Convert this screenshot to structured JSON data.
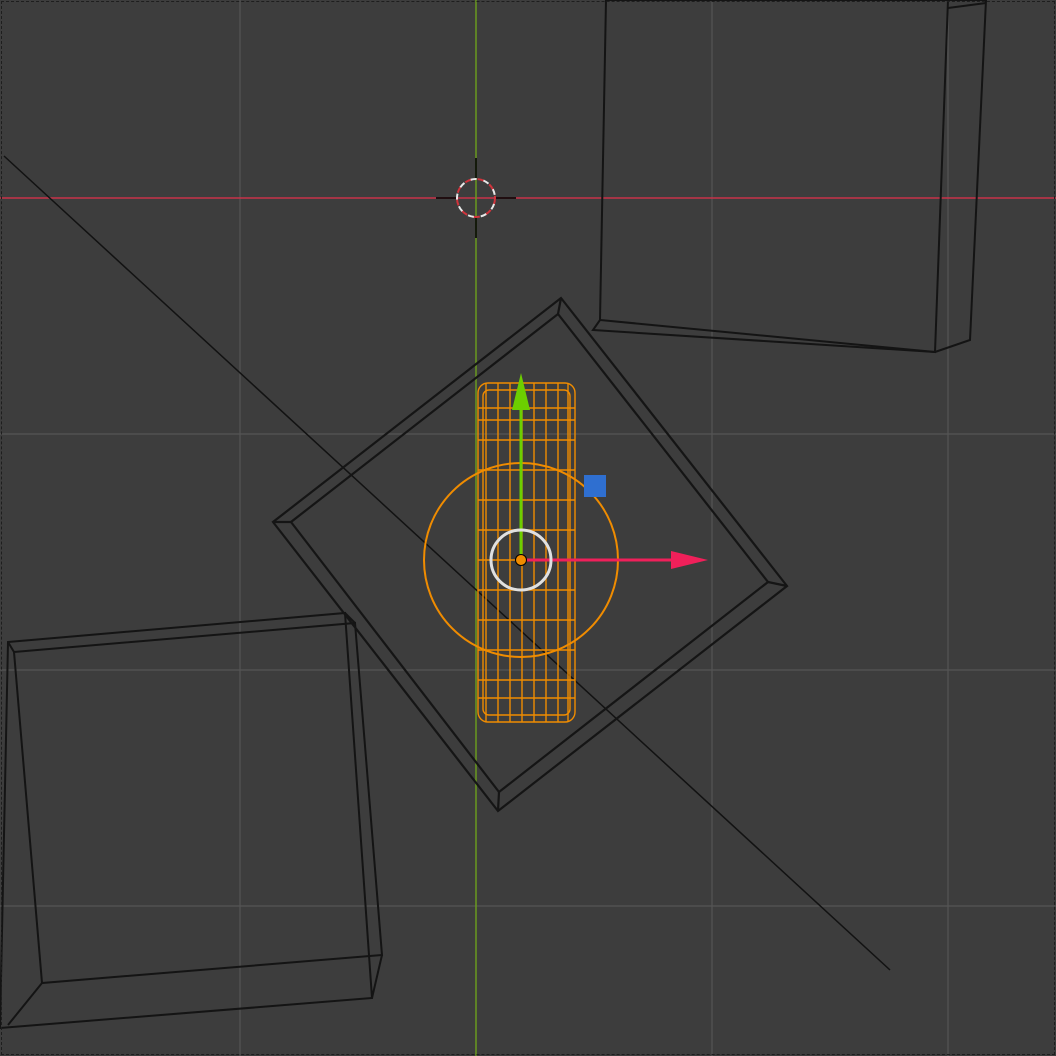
{
  "viewport": {
    "view": "top-orthographic",
    "shading": "wireframe"
  },
  "colors": {
    "background": "#3d3d3d",
    "grid": "#555555",
    "x_axis": "#c8334a",
    "y_axis": "#6a9a1e",
    "selection": "#f08c00",
    "gizmo_x": "#f0205a",
    "gizmo_y": "#6ccf00",
    "gizmo_z": "#2f6fd0",
    "wire": "#121212",
    "cursor_red": "#d0343c",
    "cursor_white": "#e8e8e8"
  },
  "objects": {
    "selected": "cylinder-object",
    "wireframes": [
      "cube-top-right",
      "cube-bottom-left",
      "plane-rotated",
      "camera-line"
    ]
  },
  "icons": {
    "cursor": "3d-cursor-icon",
    "pivot": "object-origin-icon",
    "gizmo": "transform-gizmo-icon"
  }
}
